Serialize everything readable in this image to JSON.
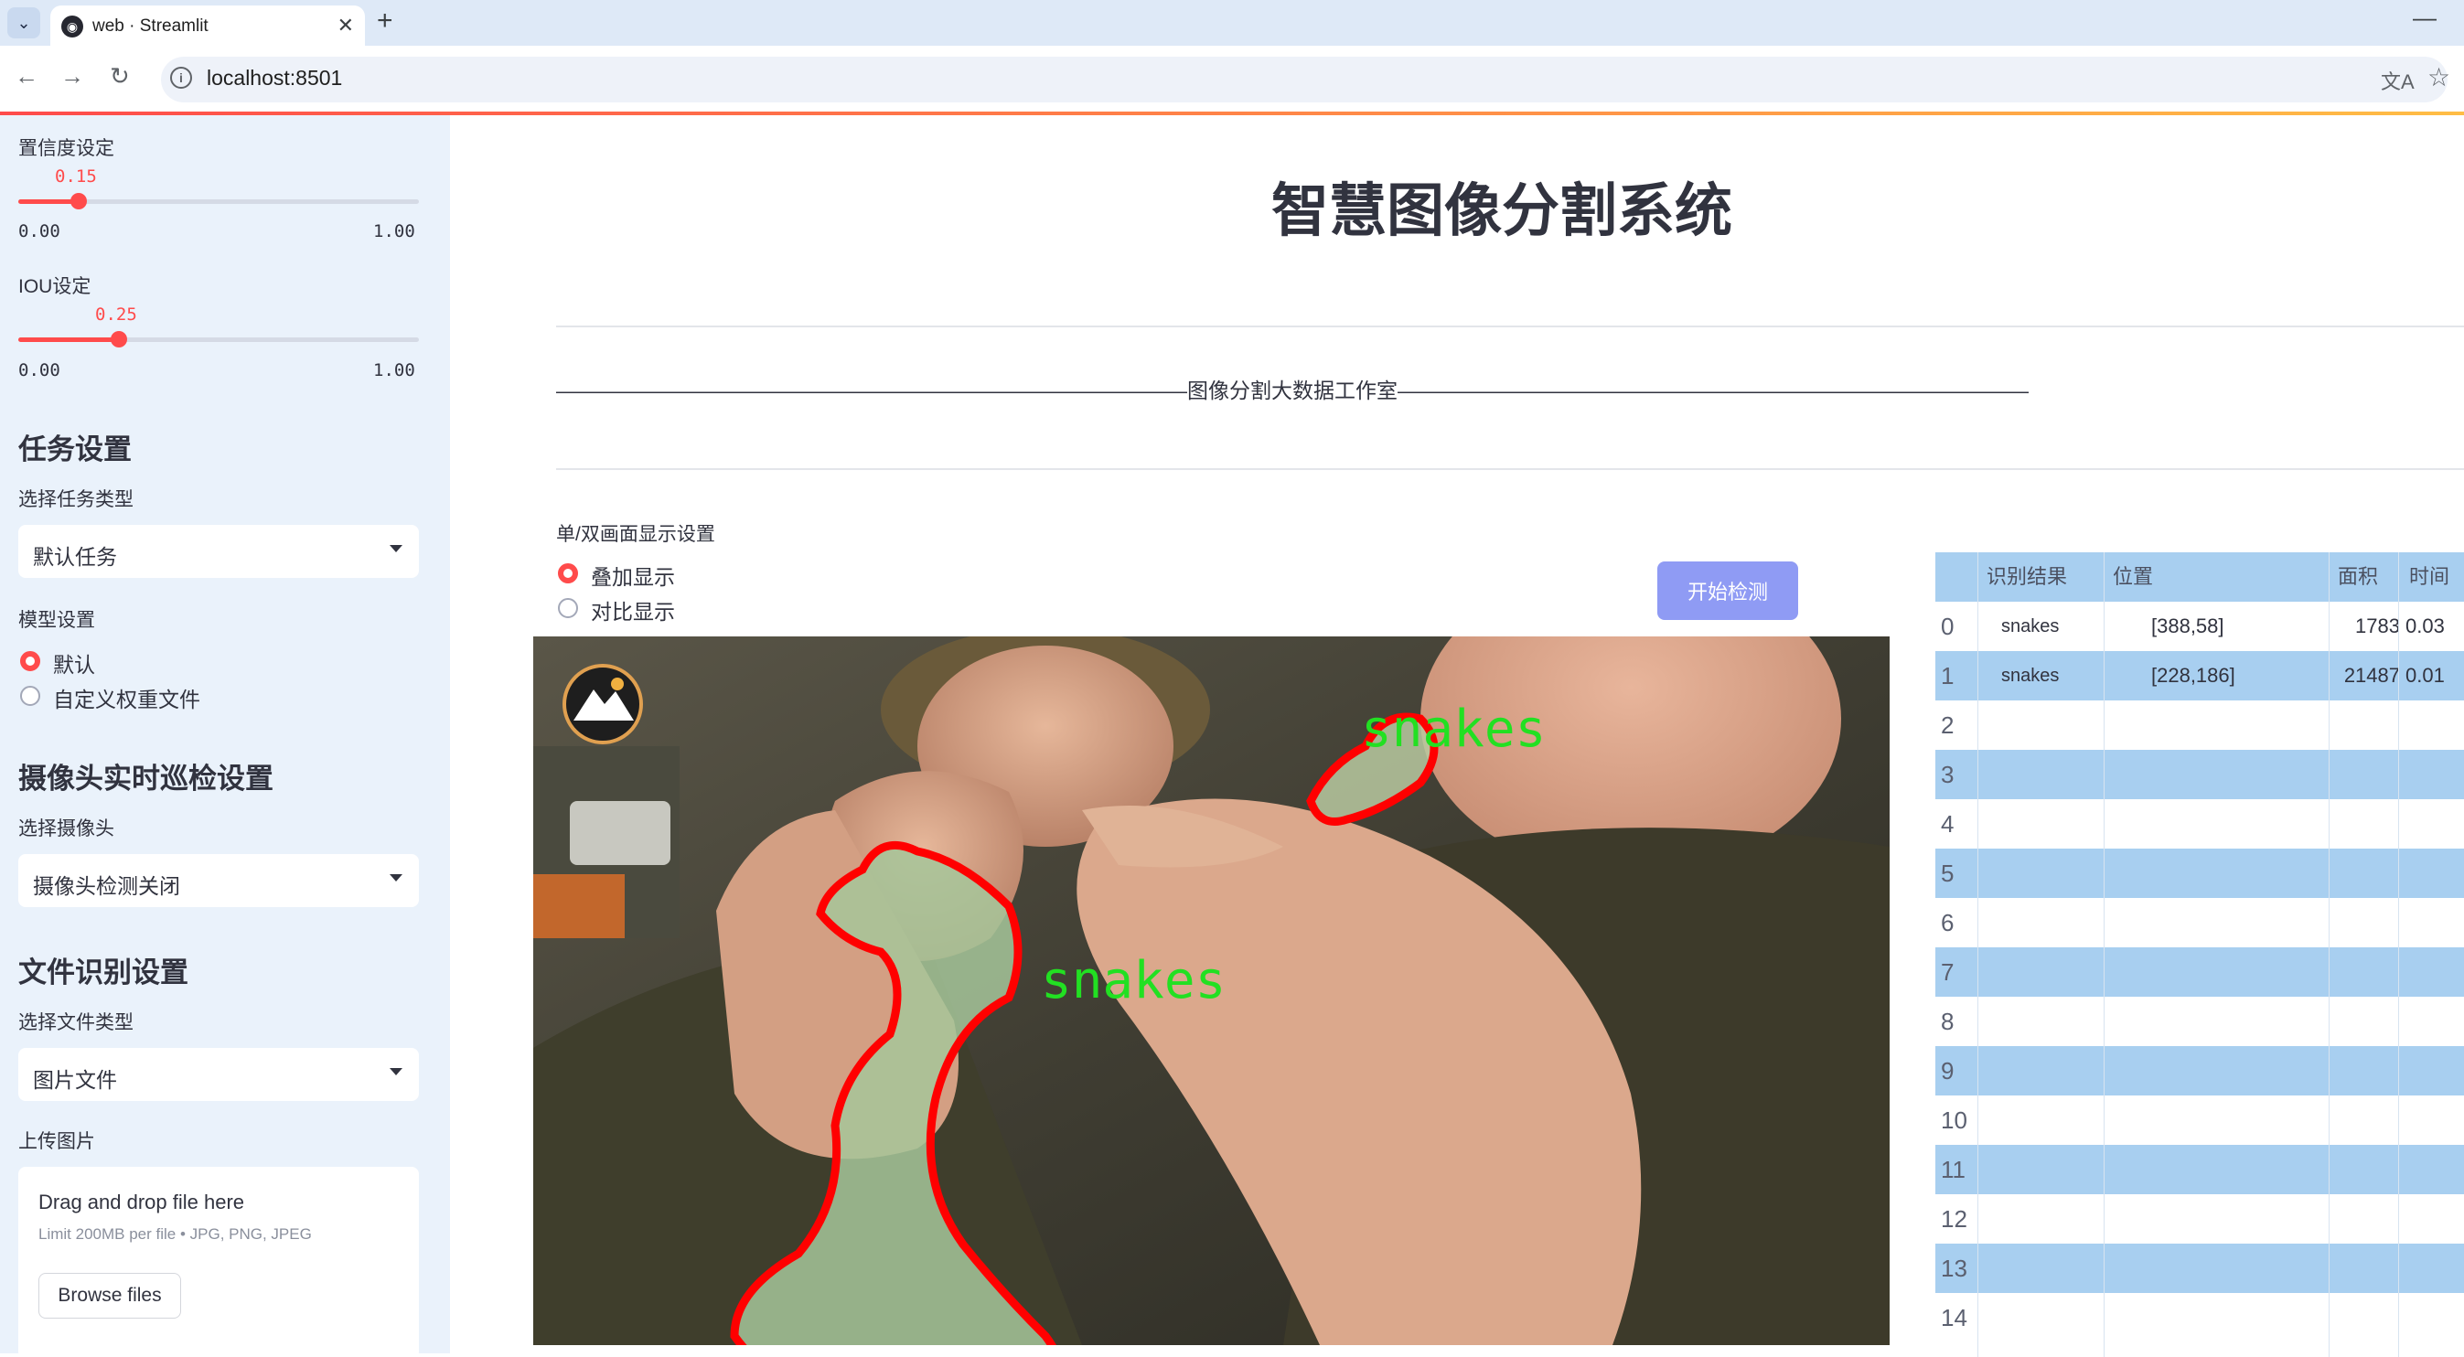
{
  "browser": {
    "tab_title": "web · Streamlit",
    "url": "localhost:8501"
  },
  "sidebar": {
    "confidence": {
      "label": "置信度设定",
      "value": "0.15",
      "value_fraction": 0.15,
      "min": "0.00",
      "max": "1.00"
    },
    "iou": {
      "label": "IOU设定",
      "value": "0.25",
      "value_fraction": 0.25,
      "min": "0.00",
      "max": "1.00"
    },
    "task_heading": "任务设置",
    "task_type_label": "选择任务类型",
    "task_type_value": "默认任务",
    "model_label": "模型设置",
    "model_options": [
      "默认",
      "自定义权重文件"
    ],
    "model_selected": 0,
    "camera_heading": "摄像头实时巡检设置",
    "camera_label": "选择摄像头",
    "camera_value": "摄像头检测关闭",
    "file_heading": "文件识别设置",
    "file_type_label": "选择文件类型",
    "file_type_value": "图片文件",
    "upload_label": "上传图片",
    "uploader": {
      "title": "Drag and drop file here",
      "limit": "Limit 200MB per file • JPG, PNG, JPEG",
      "button": "Browse files"
    }
  },
  "main": {
    "title": "智慧图像分割系统",
    "banner": "——————————————————————————————图像分割大数据工作室——————————————————————————————",
    "display_label": "单/双画面显示设置",
    "display_options": [
      "叠加显示",
      "对比显示"
    ],
    "display_selected": 0,
    "start_button": "开始检测",
    "detections": [
      {
        "label": "snakes"
      },
      {
        "label": "snakes"
      }
    ]
  },
  "table": {
    "columns": [
      "",
      "识别结果",
      "位置",
      "面积",
      "时间"
    ],
    "rows": [
      {
        "index": "0",
        "result": "snakes",
        "position": "[388,58]",
        "area": "1783",
        "time": "0.03"
      },
      {
        "index": "1",
        "result": "snakes",
        "position": "[228,186]",
        "area": "21487",
        "time": "0.01"
      },
      {
        "index": "2",
        "result": "",
        "position": "",
        "area": "",
        "time": ""
      },
      {
        "index": "3",
        "result": "",
        "position": "",
        "area": "",
        "time": ""
      },
      {
        "index": "4",
        "result": "",
        "position": "",
        "area": "",
        "time": ""
      },
      {
        "index": "5",
        "result": "",
        "position": "",
        "area": "",
        "time": ""
      },
      {
        "index": "6",
        "result": "",
        "position": "",
        "area": "",
        "time": ""
      },
      {
        "index": "7",
        "result": "",
        "position": "",
        "area": "",
        "time": ""
      },
      {
        "index": "8",
        "result": "",
        "position": "",
        "area": "",
        "time": ""
      },
      {
        "index": "9",
        "result": "",
        "position": "",
        "area": "",
        "time": ""
      },
      {
        "index": "10",
        "result": "",
        "position": "",
        "area": "",
        "time": ""
      },
      {
        "index": "11",
        "result": "",
        "position": "",
        "area": "",
        "time": ""
      },
      {
        "index": "12",
        "result": "",
        "position": "",
        "area": "",
        "time": ""
      },
      {
        "index": "13",
        "result": "",
        "position": "",
        "area": "",
        "time": ""
      },
      {
        "index": "14",
        "result": "",
        "position": "",
        "area": "",
        "time": ""
      }
    ]
  },
  "colors": {
    "accent": "#ff4b4b",
    "sidebar_bg": "#eaf2fb",
    "table_stripe": "#a8cff0",
    "mask_outline": "#ff0000",
    "label_green": "#22e022",
    "button": "#8f9bf4"
  },
  "icons": [
    "tab-dropdown-icon",
    "streamlit-favicon",
    "close-icon",
    "plus-icon",
    "back-icon",
    "forward-icon",
    "reload-icon",
    "site-info-icon",
    "translate-icon",
    "star-icon",
    "chevron-down-icon",
    "mountain-logo-icon"
  ]
}
